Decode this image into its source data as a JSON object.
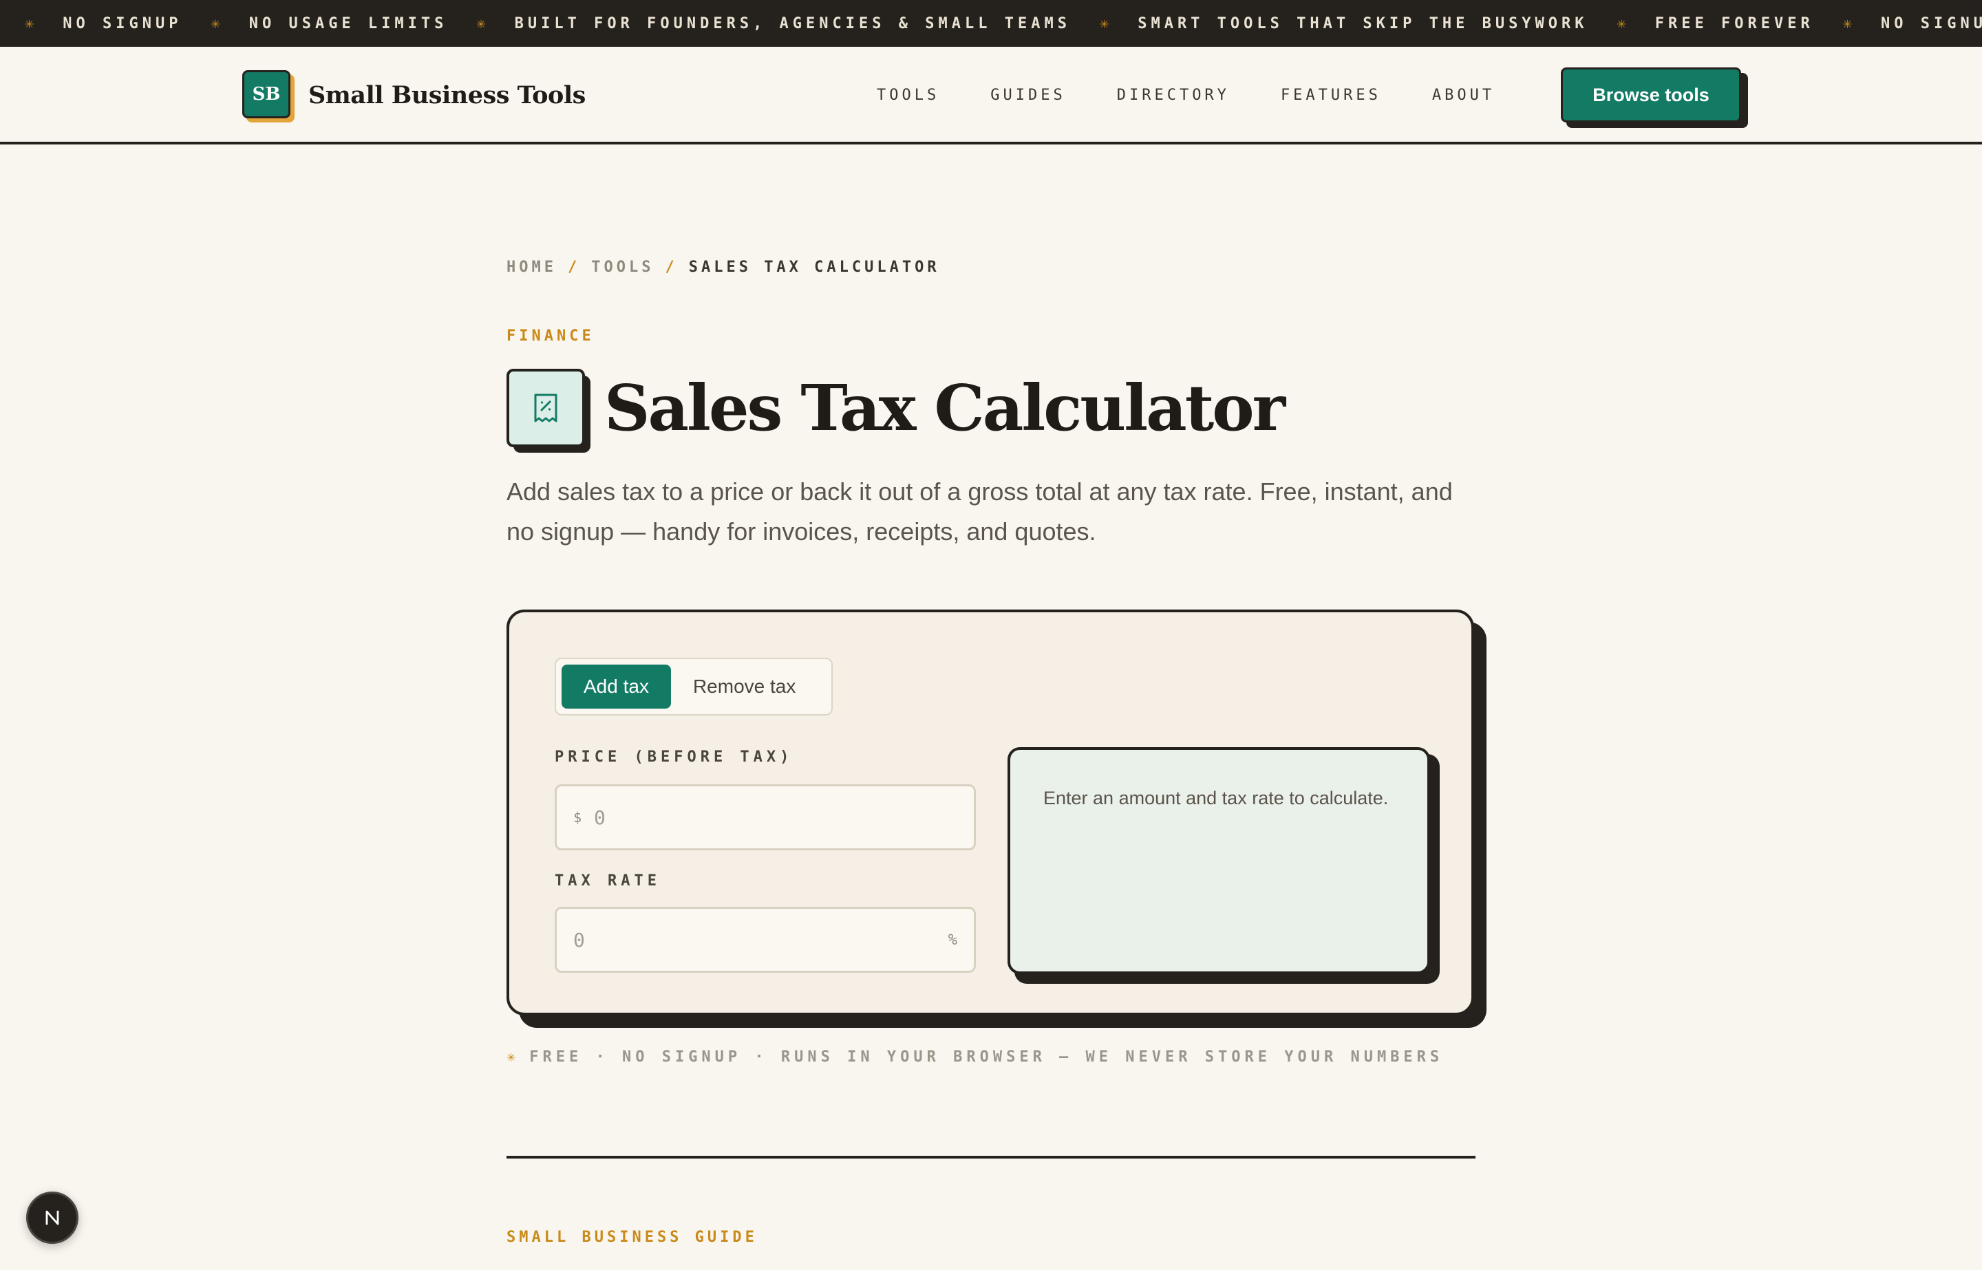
{
  "ticker": {
    "items": [
      "NO SIGNUP",
      "NO USAGE LIMITS",
      "BUILT FOR FOUNDERS, AGENCIES & SMALL TEAMS",
      "SMART TOOLS THAT SKIP THE BUSYWORK",
      "FREE FOREVER",
      "NO SIGNU"
    ],
    "separator": "✳"
  },
  "header": {
    "logo_mark": "SB",
    "logo_name": "Small Business Tools",
    "nav": [
      "TOOLS",
      "GUIDES",
      "DIRECTORY",
      "FEATURES",
      "ABOUT"
    ],
    "cta_label": "Browse tools"
  },
  "breadcrumb": {
    "home": "HOME",
    "tools": "TOOLS",
    "current": "SALES TAX CALCULATOR",
    "separator": "/"
  },
  "page": {
    "category": "FINANCE",
    "title": "Sales Tax Calculator",
    "title_icon": "receipt-percent-icon",
    "lede": "Add sales tax to a price or back it out of a gross total at any tax rate. Free, instant, and no signup — handy for invoices, receipts, and quotes."
  },
  "calculator": {
    "modes": [
      "Add tax",
      "Remove tax"
    ],
    "active_mode": "Add tax",
    "price_label": "PRICE (BEFORE TAX)",
    "price_prefix": "$",
    "price_value": "0",
    "rate_label": "TAX RATE",
    "rate_value": "0",
    "rate_suffix": "%",
    "result_text": "Enter an amount and tax rate to calculate."
  },
  "footnote": {
    "star": "✳",
    "text": "FREE · NO SIGNUP · RUNS IN YOUR BROWSER — WE NEVER STORE YOUR NUMBERS"
  },
  "guide": {
    "eyebrow": "SMALL BUSINESS GUIDE"
  },
  "badge": {
    "letter": "N"
  },
  "colors": {
    "accent": "#137a64",
    "gold": "#c98a1c",
    "ink": "#25221e",
    "background": "#f9f6ef"
  }
}
